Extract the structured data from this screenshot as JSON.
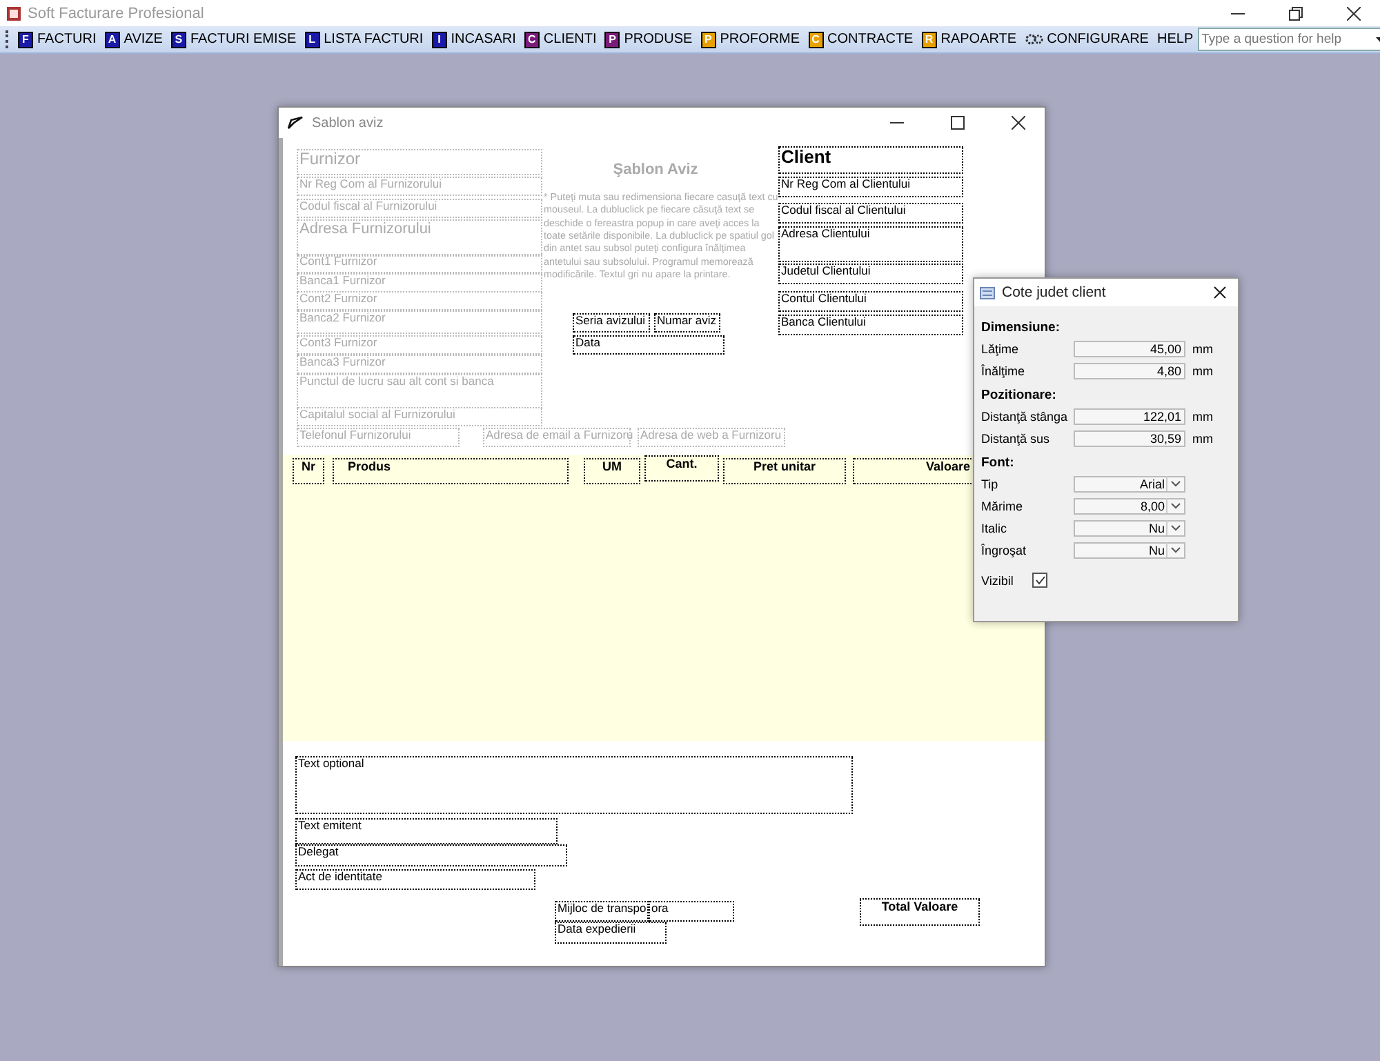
{
  "app": {
    "title": "Soft Facturare Profesional"
  },
  "menu": [
    {
      "label": "FACTURI",
      "kind": "letter",
      "letter": "F",
      "color": "#1a1aa8"
    },
    {
      "label": "AVIZE",
      "kind": "letter",
      "letter": "A",
      "color": "#1a1aa8"
    },
    {
      "label": "FACTURI EMISE",
      "kind": "letter",
      "letter": "S",
      "color": "#1a1aa8"
    },
    {
      "label": "LISTA FACTURI",
      "kind": "letter",
      "letter": "L",
      "color": "#1a1aa8"
    },
    {
      "label": "INCASARI",
      "kind": "letter",
      "letter": "I",
      "color": "#1a1aa8"
    },
    {
      "label": "CLIENTI",
      "kind": "letter",
      "letter": "C",
      "color": "#7a1a7a"
    },
    {
      "label": "PRODUSE",
      "kind": "letter",
      "letter": "P",
      "color": "#7a1a7a"
    },
    {
      "label": "PROFORME",
      "kind": "letter",
      "letter": "P",
      "color": "#e8a000"
    },
    {
      "label": "CONTRACTE",
      "kind": "letter",
      "letter": "C",
      "color": "#e8a000"
    },
    {
      "label": "RAPOARTE",
      "kind": "letter",
      "letter": "R",
      "color": "#e8a000"
    },
    {
      "label": "CONFIGURARE",
      "kind": "gear"
    },
    {
      "label": "HELP",
      "kind": "plain"
    }
  ],
  "help_search": {
    "placeholder": "Type a question for help"
  },
  "form": {
    "title": "Sablon aviz",
    "heading": "Şablon Aviz",
    "note": "* Puteţi muta sau redimensiona fiecare casuţă text cu mouseul. La dubluclick pe fiecare căsuţă text se deschide o fereastra popup in care aveţi acces la toate setările disponibile. La dubluclick pe spatiul gol din antet sau subsol puteţi configura înălţimea antetului sau subsolului. Programul memorează modificările. Textul gri nu apare la printare.",
    "header_fields": [
      {
        "text": "Furnizor",
        "kind": "hint"
      },
      {
        "text": "Nr Reg Com al Furnizorului",
        "kind": "hint"
      },
      {
        "text": "Codul fiscal al Furnizorului",
        "kind": "hint"
      },
      {
        "text": "Adresa Furnizorului",
        "kind": "hint"
      },
      {
        "text": "Cont1 Furnizor",
        "kind": "hint"
      },
      {
        "text": "Banca1 Furnizor",
        "kind": "hint"
      },
      {
        "text": "Cont2 Furnizor",
        "kind": "hint"
      },
      {
        "text": "Banca2 Furnizor",
        "kind": "hint"
      },
      {
        "text": "Cont3 Furnizor",
        "kind": "hint"
      },
      {
        "text": "Banca3 Furnizor",
        "kind": "hint"
      },
      {
        "text": "Punctul de lucru sau alt cont si banca",
        "kind": "hint"
      },
      {
        "text": "Capitalul social al Furnizorului",
        "kind": "hint"
      },
      {
        "text": "Telefonul Furnizorului",
        "kind": "hint"
      },
      {
        "text": "Adresa de email a Furnizoru",
        "kind": "hint"
      },
      {
        "text": "Adresa de web a Furnizoru",
        "kind": "hint"
      },
      {
        "text": "Seria avizului",
        "kind": "field"
      },
      {
        "text": "Numar aviz",
        "kind": "field"
      },
      {
        "text": "Data",
        "kind": "field"
      },
      {
        "text": "Client",
        "kind": "field"
      },
      {
        "text": "Nr Reg Com al Clientului",
        "kind": "field"
      },
      {
        "text": "Codul fiscal al Clientului",
        "kind": "field"
      },
      {
        "text": "Adresa Clientului",
        "kind": "field"
      },
      {
        "text": "Judetul Clientului",
        "kind": "field"
      },
      {
        "text": "Contul Clientului",
        "kind": "field"
      },
      {
        "text": "Banca Clientului",
        "kind": "field"
      }
    ],
    "columns": [
      "Nr",
      "Produs",
      "UM",
      "Cant.",
      "Pret unitar",
      "Valoare"
    ],
    "footer_fields": [
      {
        "text": "Text optional"
      },
      {
        "text": "Text emitent"
      },
      {
        "text": "Delegat"
      },
      {
        "text": "Act de identitate"
      },
      {
        "text": "Mijloc de transpo"
      },
      {
        "text": "ora"
      },
      {
        "text": "Data expedierii"
      },
      {
        "text": "Total Valoare"
      }
    ]
  },
  "popup": {
    "title": "Cote judet client",
    "sections": [
      {
        "title": "Dimensiune:",
        "rows": [
          {
            "label": "Lăţime",
            "value": "45,00",
            "unit": "mm",
            "kind": "number"
          },
          {
            "label": "Înălţime",
            "value": "4,80",
            "unit": "mm",
            "kind": "number"
          }
        ]
      },
      {
        "title": "Pozitionare:",
        "rows": [
          {
            "label": "Distanţă stânga",
            "value": "122,01",
            "unit": "mm",
            "kind": "number"
          },
          {
            "label": "Distanţă sus",
            "value": "30,59",
            "unit": "mm",
            "kind": "number"
          }
        ]
      },
      {
        "title": "Font:",
        "rows": [
          {
            "label": "Tip",
            "value": "Arial",
            "kind": "select"
          },
          {
            "label": "Mărime",
            "value": "8,00",
            "kind": "select"
          },
          {
            "label": "Italic",
            "value": "Nu",
            "kind": "select"
          },
          {
            "label": "Îngroşat",
            "value": "Nu",
            "kind": "select"
          }
        ]
      }
    ],
    "visible": {
      "label": "Vizibil",
      "checked": true
    }
  }
}
